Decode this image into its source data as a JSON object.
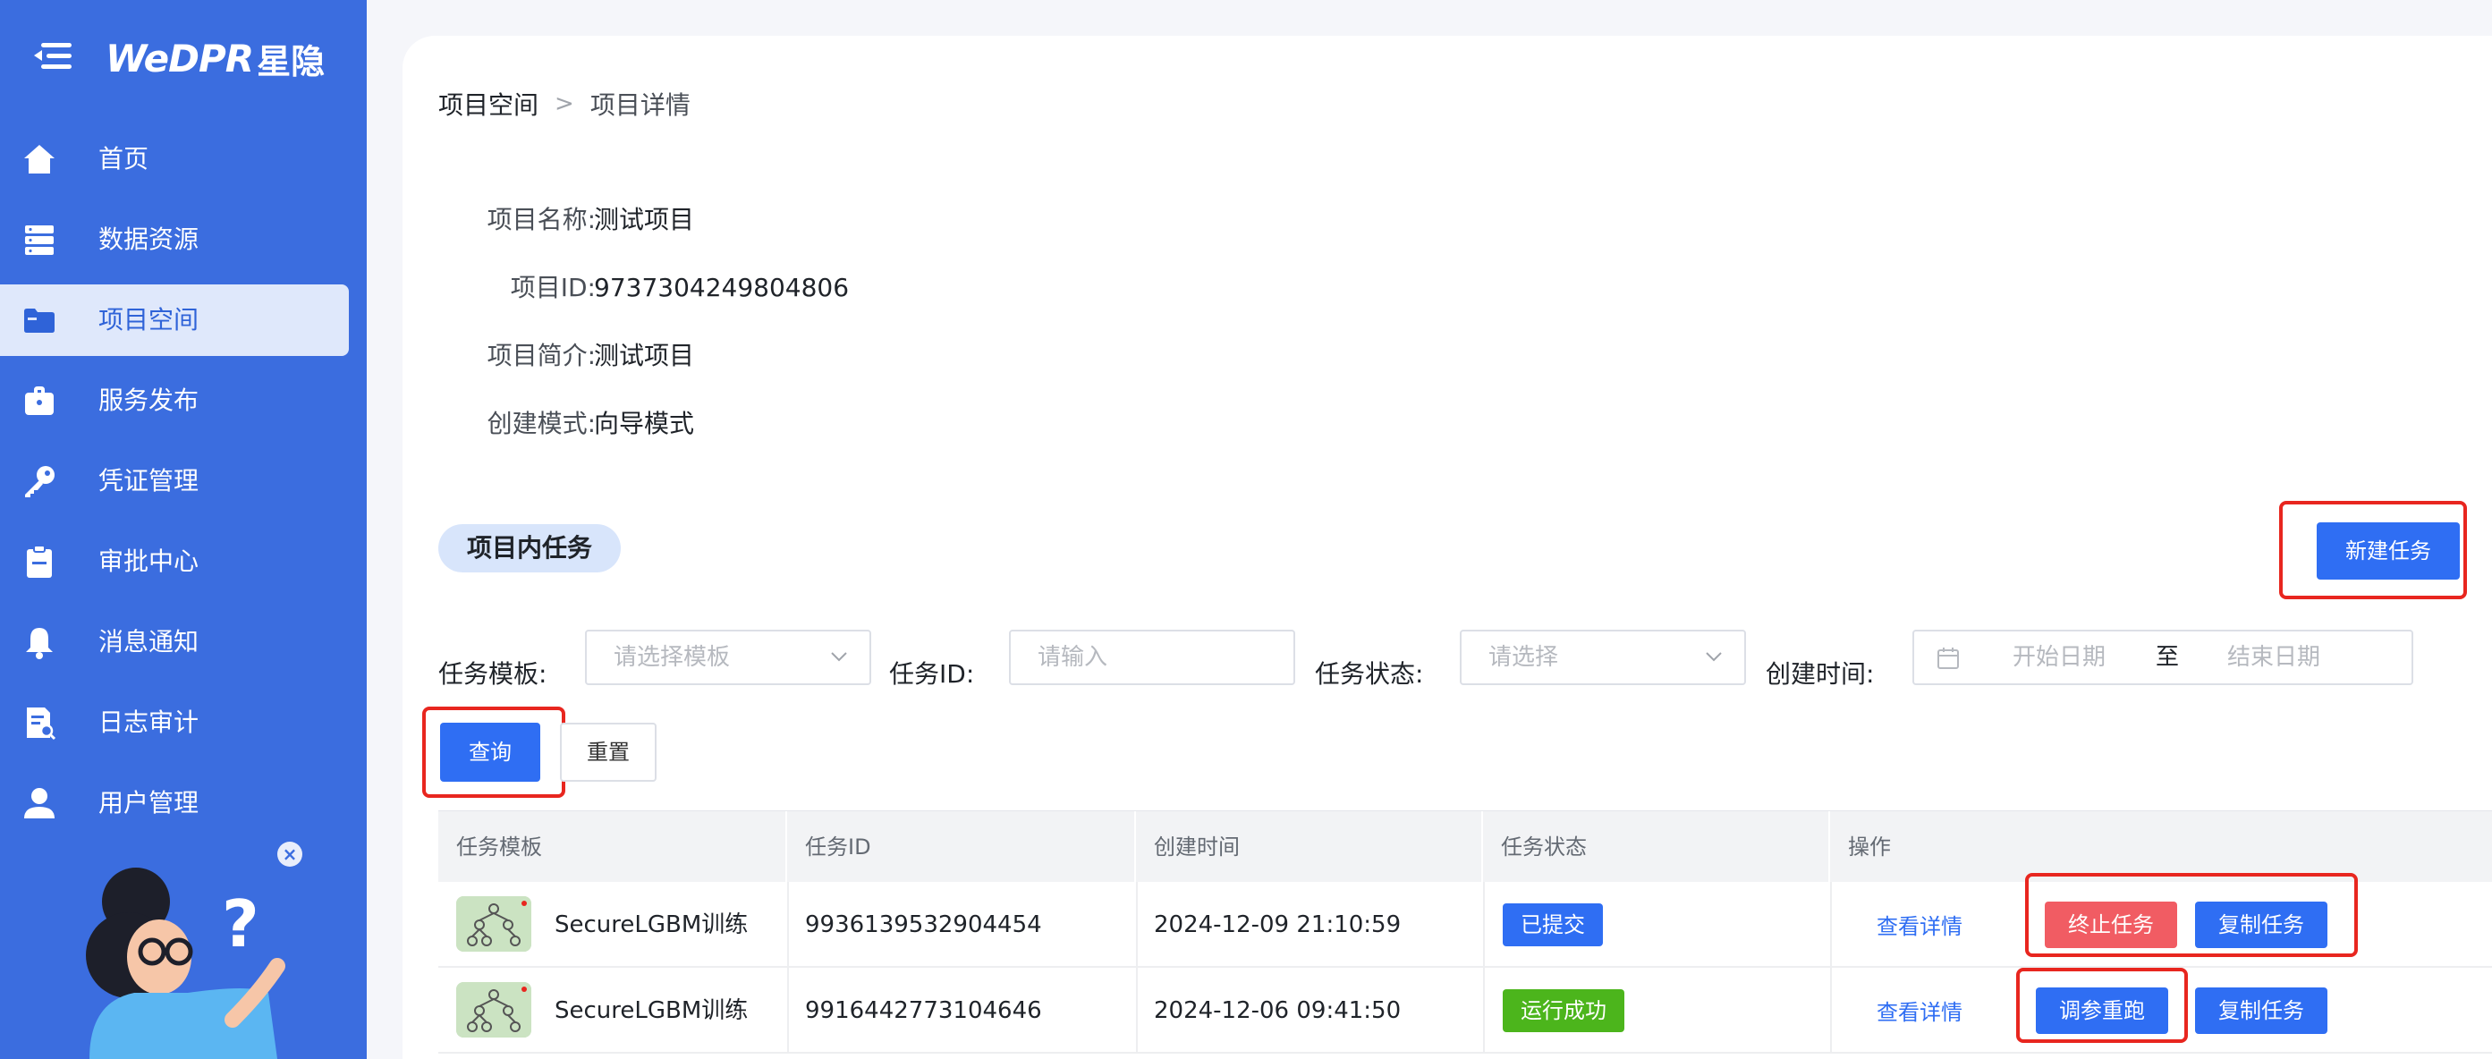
{
  "app": {
    "brand": "WeDPR",
    "brand_cn": "星隐"
  },
  "sidebar": {
    "items": [
      {
        "label": "首页",
        "icon": "home-icon"
      },
      {
        "label": "数据资源",
        "icon": "database-icon"
      },
      {
        "label": "项目空间",
        "icon": "folder-icon",
        "active": true
      },
      {
        "label": "服务发布",
        "icon": "briefcase-icon"
      },
      {
        "label": "凭证管理",
        "icon": "key-icon"
      },
      {
        "label": "审批中心",
        "icon": "clipboard-icon"
      },
      {
        "label": "消息通知",
        "icon": "bell-icon"
      },
      {
        "label": "日志审计",
        "icon": "audit-log-icon"
      },
      {
        "label": "用户管理",
        "icon": "user-icon"
      }
    ]
  },
  "breadcrumb": {
    "parent": "项目空间",
    "separator": ">",
    "current": "项目详情"
  },
  "project": {
    "name_label": "项目名称:",
    "name": "测试项目",
    "id_label": "项目ID:",
    "id": "9737304249804806",
    "desc_label": "项目简介:",
    "desc": "测试项目",
    "mode_label": "创建模式:",
    "mode": "向导模式"
  },
  "tasks_section": {
    "title": "项目内任务",
    "new_task_label": "新建任务"
  },
  "filters": {
    "template_label": "任务模板:",
    "template_placeholder": "请选择模板",
    "task_id_label": "任务ID:",
    "task_id_placeholder": "请输入",
    "status_label": "任务状态:",
    "status_placeholder": "请选择",
    "created_label": "创建时间:",
    "start_placeholder": "开始日期",
    "range_sep": "至",
    "end_placeholder": "结束日期",
    "query_label": "查询",
    "reset_label": "重置"
  },
  "table": {
    "headers": [
      "任务模板",
      "任务ID",
      "创建时间",
      "任务状态",
      "操作"
    ],
    "rows": [
      {
        "template": "SecureLGBM训练",
        "task_id": "9936139532904454",
        "created": "2024-12-09 21:10:59",
        "status": "已提交",
        "status_color": "#2f6ef3",
        "actions": {
          "view": "查看详情",
          "primary": "终止任务",
          "copy": "复制任务"
        }
      },
      {
        "template": "SecureLGBM训练",
        "task_id": "9916442773104646",
        "created": "2024-12-06 09:41:50",
        "status": "运行成功",
        "status_color": "#4cb51c",
        "actions": {
          "view": "查看详情",
          "primary": "调参重跑",
          "copy": "复制任务"
        }
      }
    ]
  },
  "colors": {
    "sidebar": "#3b6ddf",
    "primary": "#2f6ef3",
    "danger": "#f15c63",
    "success": "#4cb51c",
    "highlight": "#e8261f"
  }
}
